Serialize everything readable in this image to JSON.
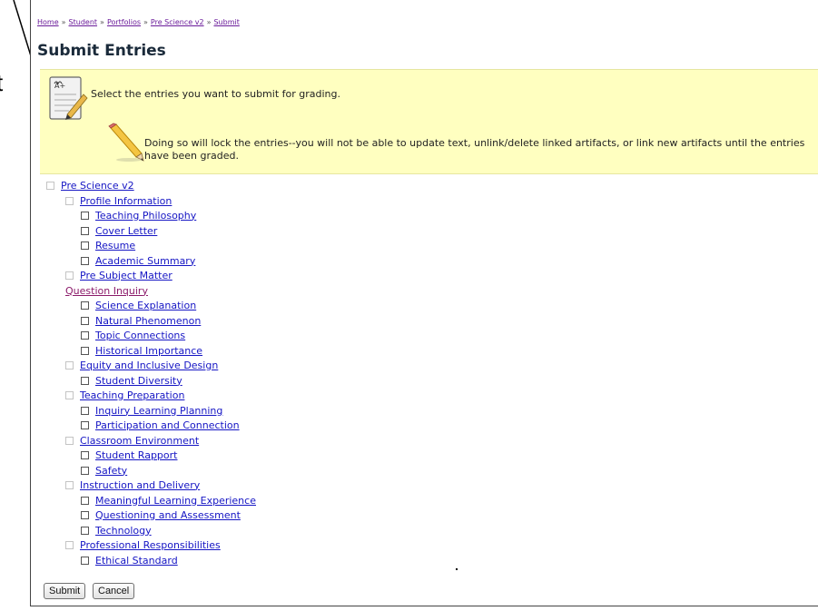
{
  "annotation": {
    "label": "t"
  },
  "breadcrumb": {
    "items": [
      "Home",
      "Student",
      "Portfolios",
      "Pre Science v2",
      "Submit"
    ],
    "separator": "»"
  },
  "page_title": "Submit Entries",
  "notice": {
    "icon": "notepad-grade-icon",
    "main_text": "Select the entries you want to submit for grading.",
    "warn_icon": "pencil-icon",
    "warn_text": "Doing so will lock the entries--you will not be able to update text, unlink/delete linked artifacts, or link new artifacts until the entries have been graded."
  },
  "tree": {
    "root": "Pre Science v2",
    "sections": [
      {
        "label": "Profile Information",
        "entries": [
          "Teaching Philosophy",
          "Cover Letter",
          "Resume",
          "Academic Summary"
        ]
      },
      {
        "label": "Pre Subject Matter",
        "sub_heading": "Question Inquiry",
        "entries": [
          "Science Explanation",
          "Natural Phenomenon",
          "Topic Connections",
          "Historical Importance"
        ]
      },
      {
        "label": "Equity and Inclusive Design",
        "entries": [
          "Student Diversity"
        ]
      },
      {
        "label": "Teaching Preparation",
        "entries": [
          "Inquiry Learning Planning",
          "Participation and Connection"
        ]
      },
      {
        "label": "Classroom Environment",
        "entries": [
          "Student Rapport",
          "Safety"
        ]
      },
      {
        "label": "Instruction and Delivery",
        "entries": [
          "Meaningful Learning Experience",
          "Questioning and Assessment",
          "Technology"
        ]
      },
      {
        "label": "Professional Responsibilities",
        "entries": [
          "Ethical Standard"
        ]
      }
    ]
  },
  "buttons": {
    "submit": "Submit",
    "cancel": "Cancel"
  },
  "colors": {
    "notice_bg": "#ffffc0",
    "link": "#1515c4",
    "visited_link": "#8b1a6a"
  }
}
